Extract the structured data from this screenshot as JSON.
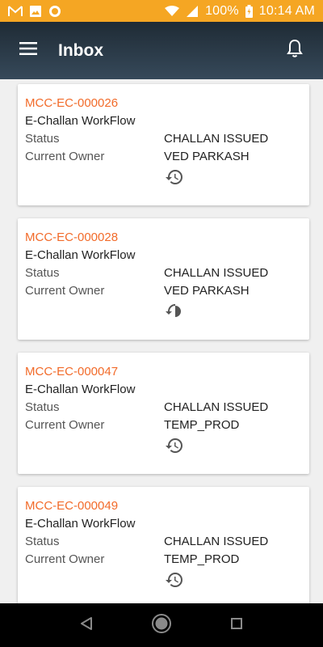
{
  "status_bar": {
    "battery": "100%",
    "time": "10:14 AM",
    "icons": [
      "gmail-icon",
      "image-icon",
      "circle-icon",
      "wifi-icon",
      "signal-icon",
      "battery-icon"
    ]
  },
  "app_bar": {
    "title": "Inbox",
    "menu_icon": "menu-icon",
    "bell_icon": "bell-icon"
  },
  "labels": {
    "status": "Status",
    "current_owner": "Current Owner"
  },
  "cards": [
    {
      "id": "MCC-EC-000026",
      "workflow": "E-Challan WorkFlow",
      "status": "CHALLAN ISSUED",
      "owner": "VED PARKASH"
    },
    {
      "id": "MCC-EC-000028",
      "workflow": "E-Challan WorkFlow",
      "status": "CHALLAN ISSUED",
      "owner": "VED PARKASH"
    },
    {
      "id": "MCC-EC-000047",
      "workflow": "E-Challan WorkFlow",
      "status": "CHALLAN ISSUED",
      "owner": "TEMP_PROD"
    },
    {
      "id": "MCC-EC-000049",
      "workflow": "E-Challan WorkFlow",
      "status": "CHALLAN ISSUED",
      "owner": "TEMP_PROD"
    }
  ],
  "colors": {
    "status_bar": "#f5a623",
    "accent": "#f26b2a",
    "app_bar": "#2b3a47"
  }
}
